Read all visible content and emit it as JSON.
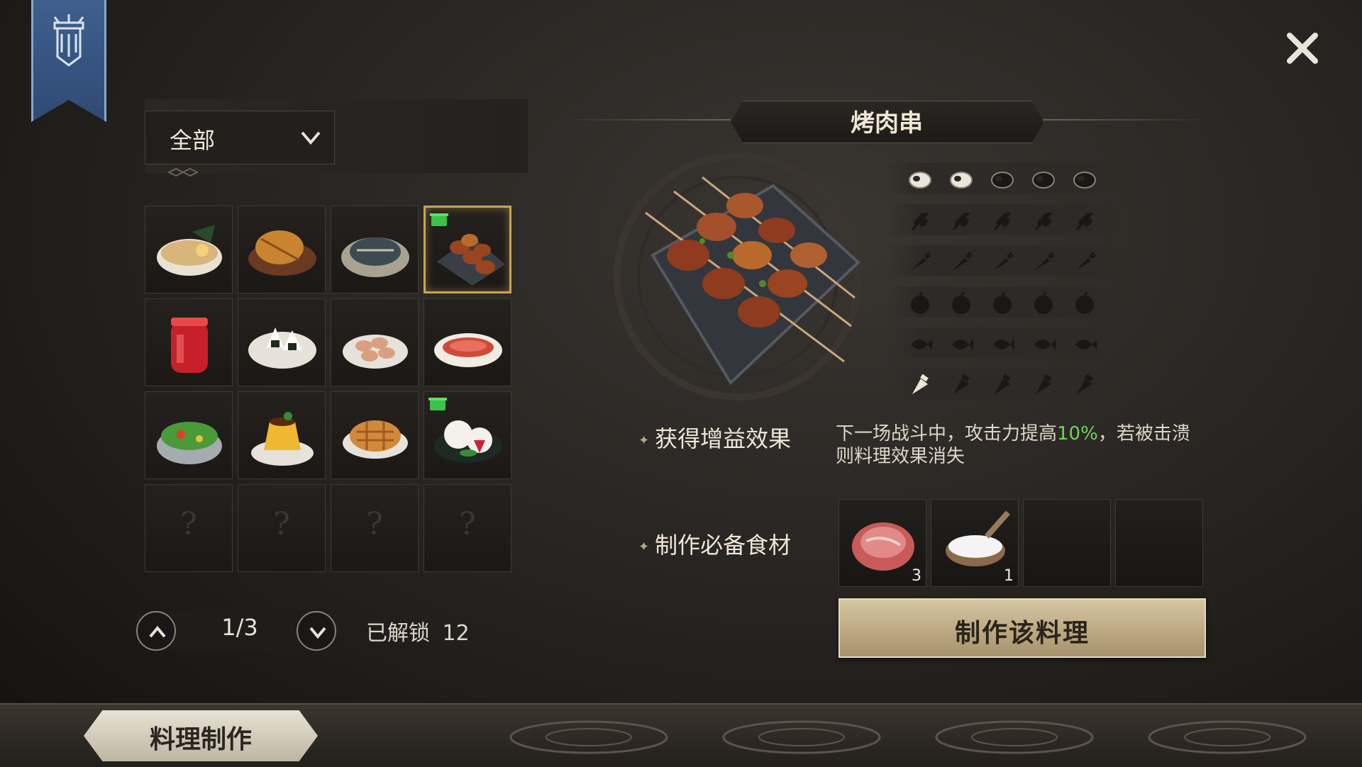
{
  "filter": {
    "selected": "全部"
  },
  "recipes": [
    {
      "name": "ramen",
      "state": "unlocked"
    },
    {
      "name": "fried-fish",
      "state": "unlocked"
    },
    {
      "name": "steamed-fish",
      "state": "unlocked"
    },
    {
      "name": "meat-skewers",
      "state": "selected",
      "owned": true
    },
    {
      "name": "jam-jar",
      "state": "unlocked"
    },
    {
      "name": "rice-balls",
      "state": "unlocked"
    },
    {
      "name": "sausage-plate",
      "state": "unlocked"
    },
    {
      "name": "sashimi-plate",
      "state": "unlocked"
    },
    {
      "name": "salad",
      "state": "unlocked"
    },
    {
      "name": "pudding",
      "state": "unlocked"
    },
    {
      "name": "pie",
      "state": "unlocked"
    },
    {
      "name": "strawberry-daifuku",
      "state": "unlocked",
      "owned": true
    },
    {
      "name": "locked",
      "state": "locked",
      "symbol": "?"
    },
    {
      "name": "locked",
      "state": "locked",
      "symbol": "?"
    },
    {
      "name": "locked",
      "state": "locked",
      "symbol": "?"
    },
    {
      "name": "locked",
      "state": "locked",
      "symbol": "?"
    }
  ],
  "pager": {
    "page": "1/3",
    "unlocked_label": "已解锁",
    "unlocked_count": "12"
  },
  "detail": {
    "title": "烤肉串",
    "attributes": [
      {
        "icon": "meat-icon",
        "filled": 2,
        "total": 5
      },
      {
        "icon": "grain-icon",
        "filled": 0,
        "total": 5
      },
      {
        "icon": "carrot-icon",
        "filled": 0,
        "total": 5
      },
      {
        "icon": "fruit-icon",
        "filled": 0,
        "total": 5
      },
      {
        "icon": "fish-icon",
        "filled": 0,
        "total": 5
      },
      {
        "icon": "seasoning-icon",
        "filled": 1,
        "total": 5
      }
    ],
    "buff_label": "获得增益效果",
    "buff_text_before": "下一场战斗中，攻击力提高",
    "buff_highlight": "10%",
    "buff_text_after": "，若被击溃则料理效果消失",
    "ingredients_label": "制作必备食材",
    "ingredients": [
      {
        "name": "raw-meat",
        "count": "3"
      },
      {
        "name": "salt-bowl",
        "count": "1"
      },
      {
        "name": "empty",
        "count": ""
      },
      {
        "name": "empty",
        "count": ""
      }
    ],
    "make_button": "制作该料理"
  },
  "bottom_tab": {
    "label": "料理制作"
  },
  "colors": {
    "accent_gold": "#c8a456",
    "buff_green": "#6fd35b",
    "banner_blue": "#3f5f8e"
  }
}
